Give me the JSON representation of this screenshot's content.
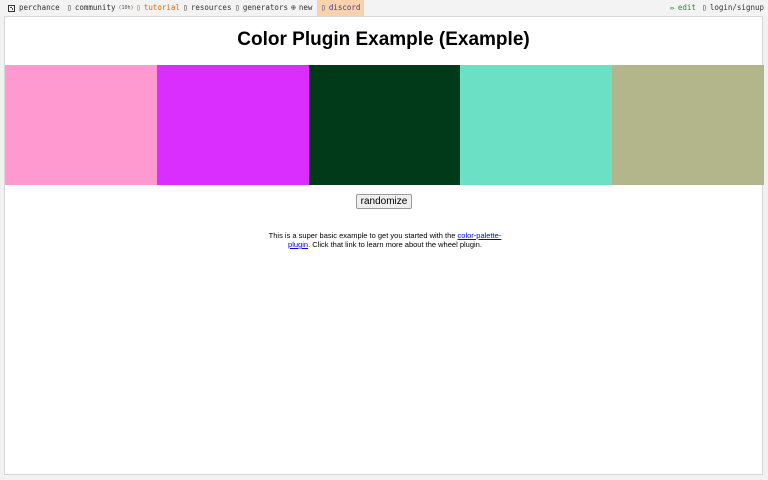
{
  "topbar": {
    "items": [
      {
        "label": "perchance"
      },
      {
        "label": "community",
        "badge": "(10h)"
      },
      {
        "label": "tutorial"
      },
      {
        "label": "resources"
      },
      {
        "label": "generators"
      },
      {
        "label": "new"
      },
      {
        "label": "discord"
      }
    ],
    "right": {
      "edit": "edit",
      "login": "login/signup"
    }
  },
  "page": {
    "title": "Color Plugin Example (Example)",
    "swatches": [
      "#ff99d0",
      "#da2eff",
      "#003a18",
      "#6be0c4",
      "#b3b68a"
    ],
    "randomize_label": "randomize",
    "description": {
      "before": "This is a super basic example to get you started with the ",
      "link": "color-palette-plugin",
      "after": ". Click that link to learn more about the wheel plugin."
    }
  }
}
